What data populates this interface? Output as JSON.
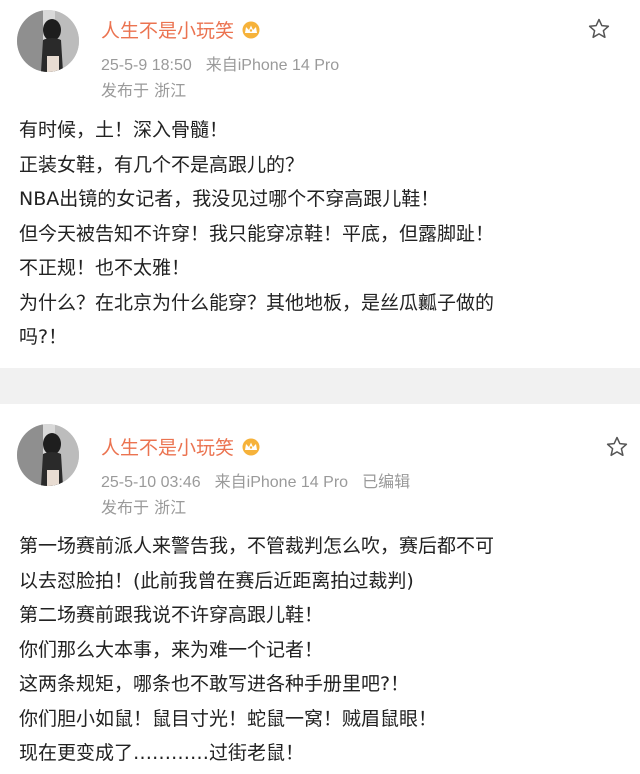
{
  "post1": {
    "author": "人生不是小玩笑",
    "date": "25-5-9 18:50",
    "source": "来自iPhone 14 Pro",
    "edited": "",
    "location": "发布于 浙江",
    "lines": [
      "有时候，土！深入骨髓！",
      "正装女鞋，有几个不是高跟儿的？",
      "NBA出镜的女记者，我没见过哪个不穿高跟儿鞋！",
      "但今天被告知不许穿！我只能穿凉鞋！平底，但露脚趾！",
      "不正规！也不太雅！",
      "为什么？在北京为什么能穿？其他地板，是丝瓜瓤子做的",
      "吗?！"
    ]
  },
  "post2": {
    "author": "人生不是小玩笑",
    "date": "25-5-10 03:46",
    "source": "来自iPhone 14 Pro",
    "edited": "已编辑",
    "location": "发布于 浙江",
    "lines": [
      "第一场赛前派人来警告我，不管裁判怎么吹，赛后都不可",
      "以去怼脸拍！(此前我曾在赛后近距离拍过裁判)",
      "第二场赛前跟我说不许穿高跟儿鞋！",
      "你们那么大本事，来为难一个记者！",
      "这两条规矩，哪条也不敢写进各种手册里吧?！",
      "你们胆小如鼠！鼠目寸光！蛇鼠一窝！贼眉鼠眼！",
      "现在更变成了…………过街老鼠！"
    ]
  },
  "icons": {
    "badge": "crown-badge-icon",
    "favorite": "star-icon"
  },
  "colors": {
    "author": "#eb7350",
    "meta": "#9a9a9a",
    "text": "#222222",
    "divider": "#f1f1f1"
  }
}
